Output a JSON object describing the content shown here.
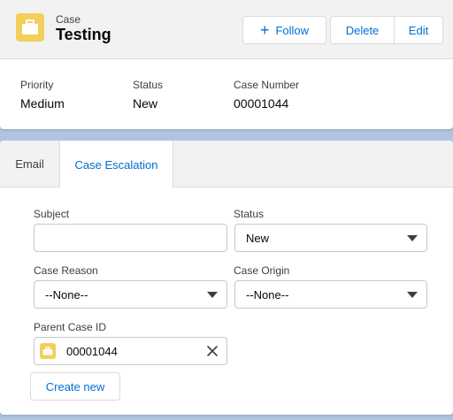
{
  "header": {
    "object_type": "Case",
    "record_title": "Testing",
    "actions": {
      "follow": "Follow",
      "delete": "Delete",
      "edit": "Edit"
    },
    "fields": [
      {
        "label": "Priority",
        "value": "Medium"
      },
      {
        "label": "Status",
        "value": "New"
      },
      {
        "label": "Case Number",
        "value": "00001044"
      }
    ]
  },
  "tabs": [
    {
      "label": "Email",
      "active": false
    },
    {
      "label": "Case Escalation",
      "active": true
    }
  ],
  "form": {
    "subject": {
      "label": "Subject",
      "value": ""
    },
    "status": {
      "label": "Status",
      "value": "New"
    },
    "case_reason": {
      "label": "Case Reason",
      "value": "--None--"
    },
    "case_origin": {
      "label": "Case Origin",
      "value": "--None--"
    },
    "parent_case": {
      "label": "Parent Case ID",
      "value": "00001044"
    },
    "submit_label": "Create new"
  },
  "icons": {
    "record": "briefcase-icon",
    "follow": "plus-icon",
    "dropdown": "caret-down-icon",
    "clear": "close-icon"
  },
  "colors": {
    "brand": "#0070d2",
    "case_icon_bg": "#f2cf5b",
    "page_bg": "#b0c4df",
    "active_tab_text": "#006dcc"
  }
}
